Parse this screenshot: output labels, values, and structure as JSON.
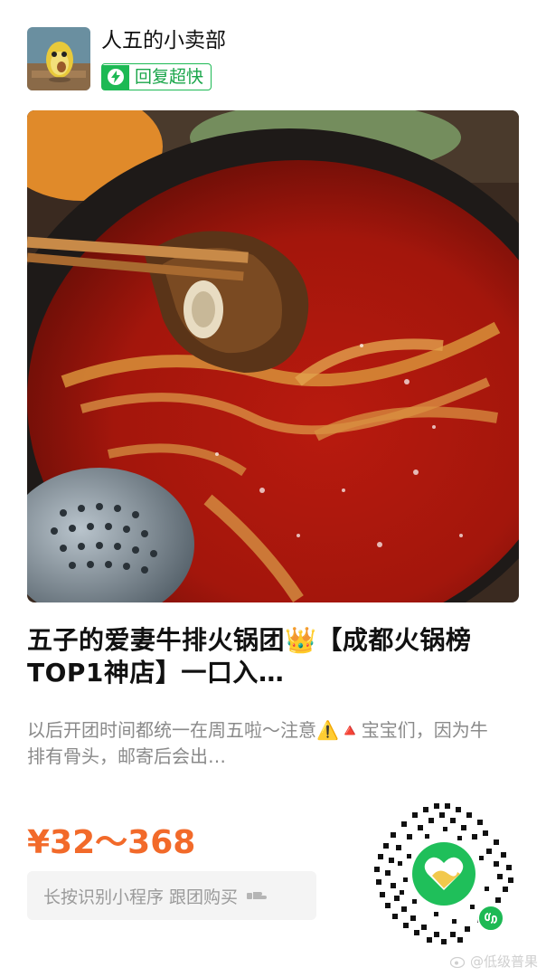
{
  "header": {
    "shop_name": "人五的小卖部",
    "reply_badge": "回复超快",
    "avatar_icon": "avocado-avatar-icon",
    "badge_icon": "lightning-icon"
  },
  "product": {
    "image_alt": "hotpot-photo",
    "title": "五子的爱妻牛排火锅团👑【成都火锅榜TOP1神店】一口入…",
    "description": "以后开团时间都统一在周五啦～注意⚠️🔺宝宝们，因为牛排有骨头，邮寄后会出…",
    "price": "¥32～368"
  },
  "action": {
    "hint": "长按识别小程序 跟团购买",
    "hint_icon": "pointing-hand-icon"
  },
  "qr": {
    "logo_icon": "heart-mini-program-icon",
    "badge_icon": "mini-program-icon"
  },
  "watermark": {
    "text": "@低级普果"
  },
  "colors": {
    "accent_green": "#1db954",
    "price_orange": "#f26a2a",
    "desc_gray": "#8a8a8a"
  }
}
